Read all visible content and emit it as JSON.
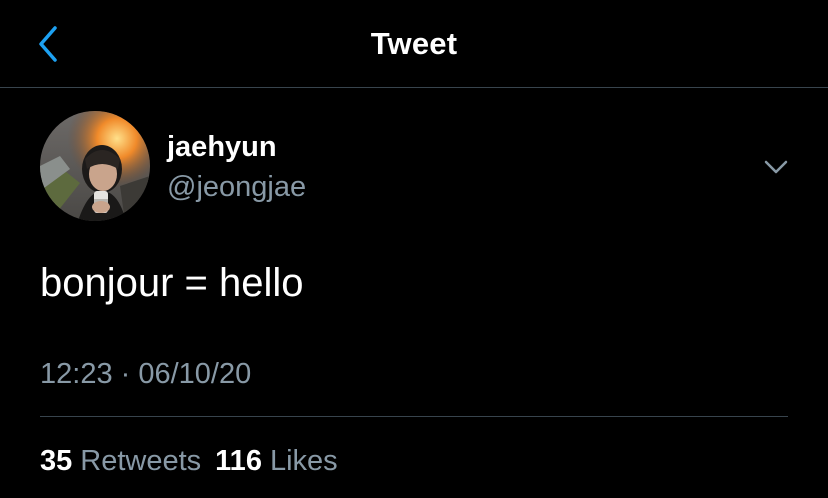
{
  "header": {
    "title": "Tweet",
    "back_icon": "chevron-left-icon"
  },
  "tweet": {
    "author": {
      "display_name": "jaehyun",
      "handle": "@jeongjae"
    },
    "text": "bonjour = hello",
    "timestamp": "12:23 · 06/10/20",
    "menu_icon": "chevron-down-icon",
    "stats": {
      "retweets_count": "35",
      "retweets_label": "Retweets",
      "likes_count": "116",
      "likes_label": "Likes"
    }
  },
  "colors": {
    "background": "#000000",
    "accent": "#1da1f2",
    "secondary_text": "#8899a6",
    "divider": "#38444d"
  }
}
